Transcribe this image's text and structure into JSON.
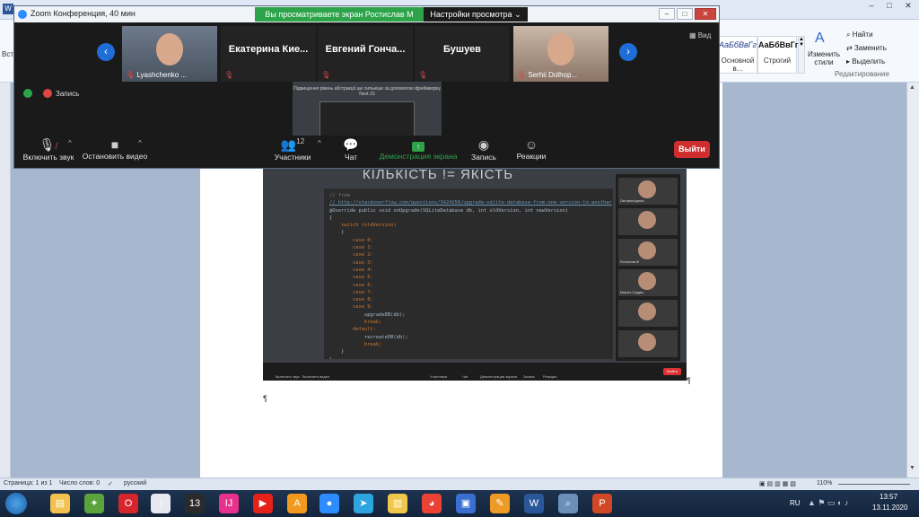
{
  "word": {
    "title_text": "",
    "styles": [
      {
        "sample": "АаБбВвГг",
        "name": "Основной в..."
      },
      {
        "sample": "АаБбВвГг,",
        "name": "Строгий"
      }
    ],
    "change_styles": "Изменить стили",
    "find": "Найти",
    "replace": "Заменить",
    "select": "Выделить",
    "editing_group": "Редактирование",
    "pilcrow": "¶",
    "status": {
      "page": "Страница: 1 из 1",
      "words": "Число слов: 0",
      "lang": "русский",
      "zoom": "110%"
    }
  },
  "taskbar": {
    "lang": "RU",
    "time": "13:57",
    "date": "13.11.2020"
  },
  "zoom": {
    "title": "Zoom Конференция, 40 мин",
    "banner": "Вы просматриваете экран Ростислав М",
    "view_settings": "Настройки просмотра",
    "view_label": "Вид",
    "recording": "Запись",
    "participants": [
      {
        "name": "Lyashchenko ...",
        "photo": true
      },
      {
        "name": "Екатерина Кие...",
        "photo": false
      },
      {
        "name": "Евгений Гонча...",
        "photo": false
      },
      {
        "name": "Бушуев",
        "photo": false
      },
      {
        "name": "Serhii Dolhop...",
        "photo": true
      }
    ],
    "toolbar": {
      "mute": "Включить звук",
      "video": "Остановить видео",
      "participants": "Участники",
      "participants_count": "12",
      "chat": "Чат",
      "share": "Демонстрация экрана",
      "record": "Запись",
      "reactions": "Реакции",
      "exit": "Выйти"
    },
    "share_thumb_title": "Підвищення рівень абстракції ще сильніше за допомогою фреймворку Nest.JS"
  },
  "slide": {
    "title": "КІЛЬКІСТЬ != ЯКІСТЬ",
    "code_lines": [
      {
        "t": "// from",
        "c": "c-com"
      },
      {
        "t": "// http://stackoverflow.com/questions/3424156/upgrade-sqlite-database-from-one-version-to-another",
        "c": "c-link"
      },
      {
        "t": "@Override public void onUpgrade(SQLiteDatabase db, int oldVersion, int newVersion)",
        "c": "c-txt"
      },
      {
        "t": "{",
        "c": "c-txt"
      },
      {
        "t": "    switch (oldVersion)",
        "c": "c-kw"
      },
      {
        "t": "    {",
        "c": "c-txt"
      },
      {
        "t": "        case 0:",
        "c": "c-kw"
      },
      {
        "t": "        case 1:",
        "c": "c-kw"
      },
      {
        "t": "        case 2:",
        "c": "c-kw"
      },
      {
        "t": "        case 3:",
        "c": "c-kw"
      },
      {
        "t": "        case 4:",
        "c": "c-kw"
      },
      {
        "t": "        case 5:",
        "c": "c-kw"
      },
      {
        "t": "        case 6:",
        "c": "c-kw"
      },
      {
        "t": "        case 7:",
        "c": "c-kw"
      },
      {
        "t": "        case 8:",
        "c": "c-kw"
      },
      {
        "t": "        case 9:",
        "c": "c-kw"
      },
      {
        "t": "            upgradeDB(db);",
        "c": "c-txt"
      },
      {
        "t": "            break;",
        "c": "c-kw"
      },
      {
        "t": "        default:",
        "c": "c-kw"
      },
      {
        "t": "            recreateDB(db);",
        "c": "c-txt"
      },
      {
        "t": "            break;",
        "c": "c-kw"
      },
      {
        "t": "    }",
        "c": "c-txt"
      },
      {
        "t": "}",
        "c": "c-txt"
      }
    ],
    "mini_names": [
      "Світлана Іщенко",
      "",
      "Ростислав М",
      "Микола Сердюк",
      "",
      ""
    ],
    "mini_toolbar": [
      "Включить звук",
      "Включить видео",
      "Участники",
      "Чат",
      "Демонстрация экрана",
      "Запись",
      "Реакции"
    ],
    "mini_exit": "Выйти"
  },
  "colors": {
    "zoom_green": "#2da44a",
    "zoom_red": "#cf2e2e",
    "zoom_blue": "#1f6dd6",
    "muted": "#e04545"
  }
}
